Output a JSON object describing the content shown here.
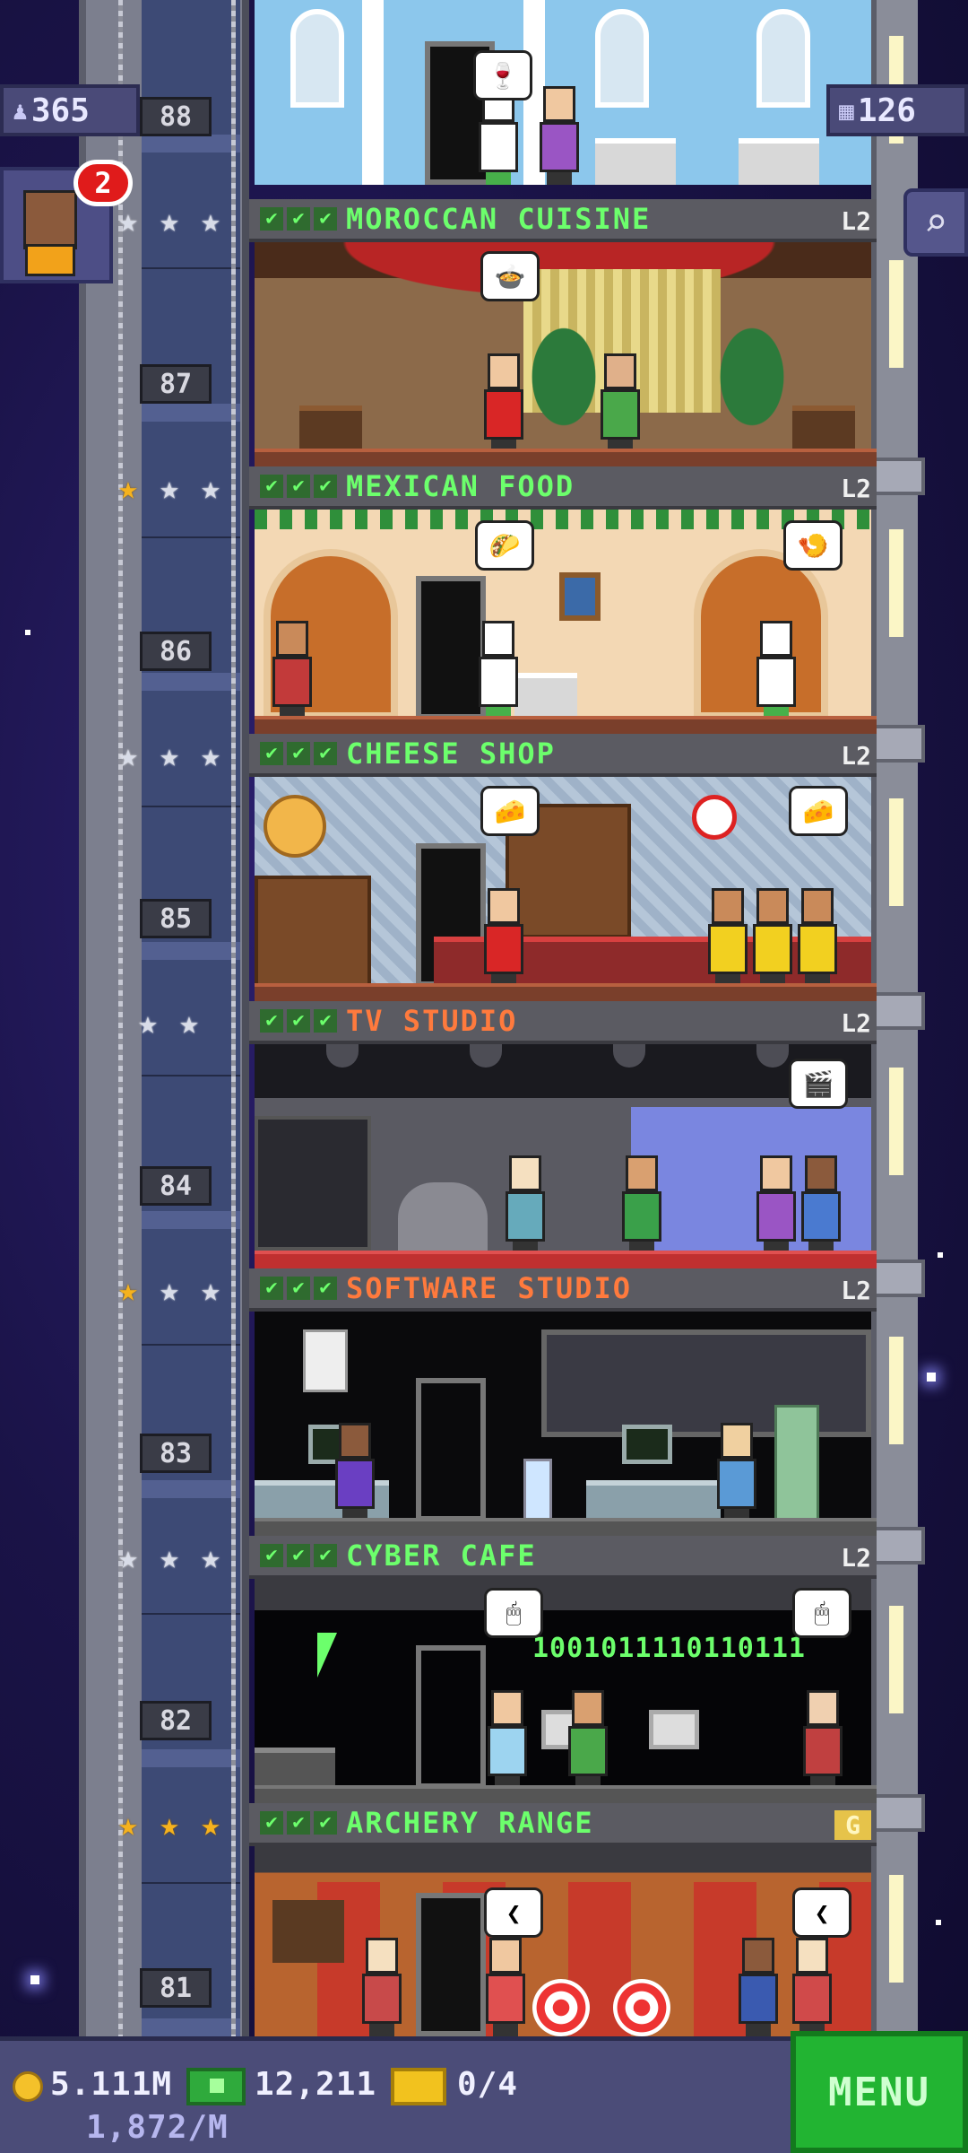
{
  "hud": {
    "population": "365",
    "floor_count": "126",
    "visitor_badge": "2",
    "coins": "5.111M",
    "coins_rate": "1,872/M",
    "bux": "12,211",
    "tickets": "0/4",
    "menu_label": "MENU"
  },
  "icons": {
    "population": "person-icon",
    "floors": "building-icon",
    "search": "magnifier-icon",
    "coins": "coin-icon",
    "bux": "bux-icon",
    "tickets": "ticket-icon"
  },
  "colors": {
    "orange_sign": "#ff7a3d",
    "green_sign": "#6cff6c",
    "menu_green": "#22b432"
  },
  "floors": [
    {
      "number": "88",
      "name": "",
      "room": "dining hall"
    },
    {
      "number": "87",
      "name": "MOROCCAN CUISINE",
      "level": "L2",
      "color": "#6cff6c",
      "stars": 0,
      "room": "moroccan"
    },
    {
      "number": "86",
      "name": "MEXICAN FOOD",
      "level": "L2",
      "color": "#6cff6c",
      "stars": 1,
      "room": "mexican"
    },
    {
      "number": "85",
      "name": "CHEESE SHOP",
      "level": "L2",
      "color": "#6cff6c",
      "stars": 0,
      "room": "cheese"
    },
    {
      "number": "84",
      "name": "TV STUDIO",
      "level": "L2",
      "color": "#ff7a3d",
      "stars": 0,
      "star_slots": 2,
      "room": "tv"
    },
    {
      "number": "83",
      "name": "SOFTWARE STUDIO",
      "level": "L2",
      "color": "#ff7a3d",
      "stars": 1,
      "room": "software"
    },
    {
      "number": "82",
      "name": "CYBER CAFE",
      "level": "L2",
      "color": "#6cff6c",
      "stars": 0,
      "room": "cyber"
    },
    {
      "number": "81",
      "name": "ARCHERY RANGE",
      "level": "G",
      "color": "#6cff6c",
      "stars": 3,
      "room": "archery"
    }
  ],
  "cyber_cafe_code": "1001011110110111",
  "bubbles": {
    "b88": "🍷",
    "b87": "🍲",
    "b86a": "🌮",
    "b86b": "🍤",
    "b85a": "🧀",
    "b85b": "🧀",
    "b84": "🎬",
    "b82a": "🖱",
    "b82b": "🖱",
    "b81a": "❮",
    "b81b": "❮"
  }
}
